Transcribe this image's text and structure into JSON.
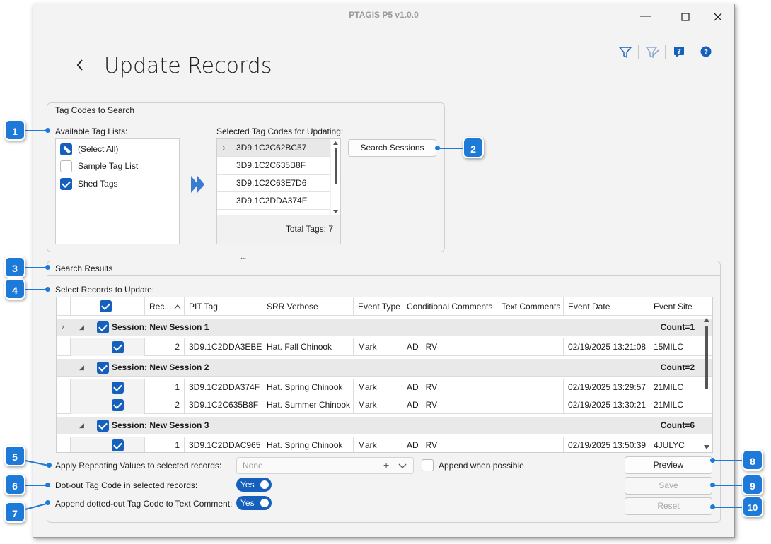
{
  "window": {
    "title": "PTAGIS P5 v1.0.0"
  },
  "page": {
    "title": "Update Records"
  },
  "tag_codes": {
    "title": "Tag Codes to Search",
    "available_label": "Available Tag Lists:",
    "lists": [
      {
        "label": "(Select All)",
        "state": "indeterminate"
      },
      {
        "label": "Sample Tag List",
        "state": "unchecked"
      },
      {
        "label": "Shed Tags",
        "state": "checked"
      }
    ],
    "selected_label": "Selected Tag Codes for Updating:",
    "selected_codes": [
      "3D9.1C2C62BC57",
      "3D9.1C2C635B8F",
      "3D9.1C2C63E7D6",
      "3D9.1C2DDA374F"
    ],
    "total_tags": "Total Tags: 7",
    "search_button": "Search Sessions"
  },
  "results": {
    "title": "Search Results",
    "select_label": "Select Records to Update:",
    "columns": [
      "Rec...",
      "PIT Tag",
      "SRR Verbose",
      "Event Type",
      "Conditional Comments",
      "Text Comments",
      "Event Date",
      "Event Site"
    ],
    "groups": [
      {
        "name": "Session: New Session 1",
        "count": "Count=1",
        "rows": [
          {
            "rec": "2",
            "pit": "3D9.1C2DDA3EBE",
            "srr": "Hat. Fall Chinook",
            "event_type": "Mark",
            "cond": "AD   RV",
            "text": "",
            "date": "02/19/2025 13:21:08",
            "site": "15MILC"
          }
        ]
      },
      {
        "name": "Session: New Session 2",
        "count": "Count=2",
        "rows": [
          {
            "rec": "1",
            "pit": "3D9.1C2DDA374F",
            "srr": "Hat. Spring Chinook",
            "event_type": "Mark",
            "cond": "AD   RV",
            "text": "",
            "date": "02/19/2025 13:29:57",
            "site": "21MILC"
          },
          {
            "rec": "2",
            "pit": "3D9.1C2C635B8F",
            "srr": "Hat. Summer Chinook",
            "event_type": "Mark",
            "cond": "AD   RV",
            "text": "",
            "date": "02/19/2025 13:30:21",
            "site": "21MILC"
          }
        ]
      },
      {
        "name": "Session: New Session 3",
        "count": "Count=6",
        "rows": [
          {
            "rec": "1",
            "pit": "3D9.1C2DDAC965",
            "srr": "Hat. Spring Chinook",
            "event_type": "Mark",
            "cond": "AD   RV",
            "text": "",
            "date": "02/19/2025 13:50:39",
            "site": "4JULYC"
          }
        ]
      }
    ]
  },
  "options": {
    "repeating_label": "Apply Repeating Values to selected records:",
    "repeating_value": "None",
    "append_label": "Append when possible",
    "dotout_label": "Dot-out Tag Code in selected records:",
    "dotout_value": "Yes",
    "append_dotted_label": "Append dotted-out Tag Code to Text Comment:",
    "append_dotted_value": "Yes"
  },
  "actions": {
    "preview": "Preview",
    "save": "Save",
    "reset": "Reset"
  },
  "callouts": [
    "1",
    "2",
    "3",
    "4",
    "5",
    "6",
    "7",
    "8",
    "9",
    "10"
  ],
  "colors": {
    "accent": "#1560bd",
    "callout": "#1e7ad9"
  }
}
